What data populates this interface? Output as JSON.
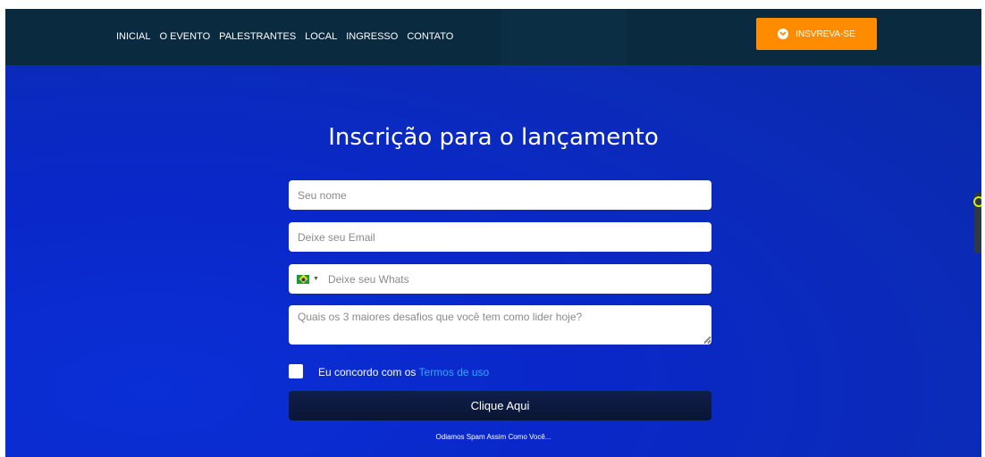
{
  "nav": {
    "links": [
      "INICIAL",
      "O EVENTO",
      "PALESTRANTES",
      "LOCAL",
      "INGRESSO",
      "CONTATO"
    ],
    "cta_label": "INSVREVA-SE",
    "cta_icon": "chevron-down-circle-icon"
  },
  "form": {
    "title": "Inscrição para o lançamento",
    "name_placeholder": "Seu nome",
    "email_placeholder": "Deixe seu Email",
    "phone_placeholder": "Deixe seu Whats",
    "phone_country_flag": "brazil-flag-icon",
    "challenges_placeholder": "Quais os 3 maiores desafios que você tem como lider hoje?",
    "agree_text": "Eu concordo com os ",
    "terms_link": "Termos de uso",
    "submit_label": "Clique Aqui",
    "spam_note": "Odiamos Spam Assim Como Você..."
  },
  "colors": {
    "nav_bg": "#0a2a3f",
    "page_bg": "#0a2bc9",
    "cta_bg": "#ff8c00",
    "submit_bg": "#0f1f4a",
    "link_color": "#2ea8ff"
  }
}
